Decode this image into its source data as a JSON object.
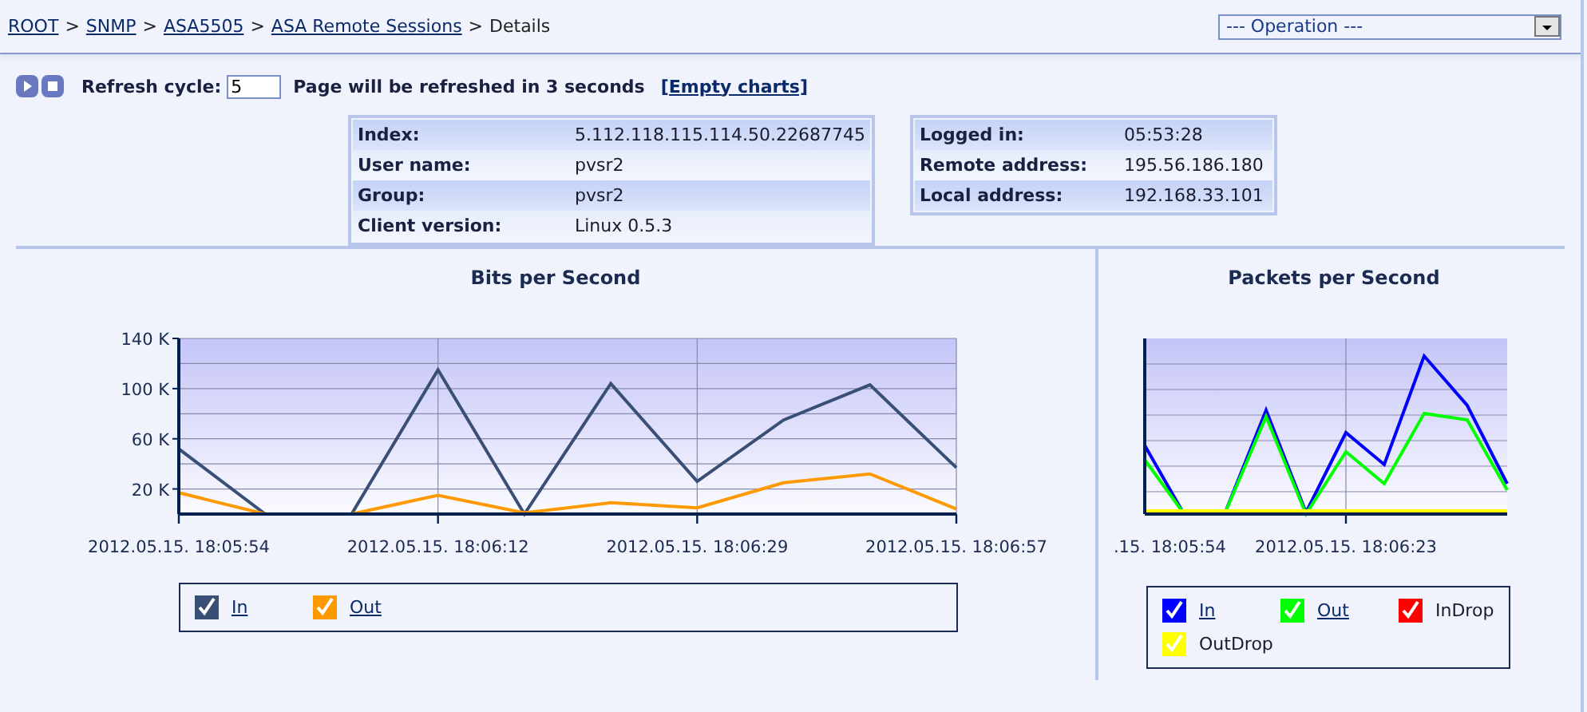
{
  "breadcrumb": {
    "separator": ">",
    "items": [
      {
        "label": "ROOT",
        "link": true
      },
      {
        "label": "SNMP",
        "link": true
      },
      {
        "label": "ASA5505",
        "link": true
      },
      {
        "label": "ASA Remote Sessions",
        "link": true
      },
      {
        "label": "Details",
        "link": false
      }
    ]
  },
  "operation_select": {
    "value": "--- Operation ---"
  },
  "toolbar": {
    "refresh_label": "Refresh cycle:",
    "refresh_value": "5",
    "status": "Page will be refreshed in 3 seconds",
    "empty_charts": "[Empty charts]"
  },
  "info_tables": [
    {
      "rows": [
        {
          "label": "Index:",
          "value": "5.112.118.115.114.50.22687745"
        },
        {
          "label": "User name:",
          "value": "pvsr2"
        },
        {
          "label": "Group:",
          "value": "pvsr2"
        },
        {
          "label": "Client version:",
          "value": "Linux 0.5.3"
        }
      ]
    },
    {
      "rows": [
        {
          "label": "Logged in:",
          "value": "05:53:28"
        },
        {
          "label": "Remote address:",
          "value": "195.56.186.180"
        },
        {
          "label": "Local address:",
          "value": "192.168.33.101"
        }
      ]
    }
  ],
  "bits_chart": {
    "chart_data": {
      "type": "line",
      "title": "Bits per Second",
      "categories": [
        "2012.05.15. 18:05:54",
        null,
        null,
        "2012.05.15. 18:06:12",
        null,
        null,
        "2012.05.15. 18:06:29",
        null,
        null,
        "2012.05.15. 18:06:57"
      ],
      "ylim": [
        0,
        140000
      ],
      "grid": true,
      "yticks": [
        {
          "value": 20000,
          "label": "20 K"
        },
        {
          "value": 60000,
          "label": "60 K"
        },
        {
          "value": 100000,
          "label": "100 K"
        },
        {
          "value": 140000,
          "label": "140 K"
        }
      ],
      "series": [
        {
          "name": "In",
          "color": "#3a4f75",
          "values": [
            52000,
            0,
            0,
            115000,
            0,
            104000,
            26000,
            75000,
            103000,
            37000
          ]
        },
        {
          "name": "Out",
          "color": "#ff9900",
          "values": [
            17000,
            0,
            0,
            15000,
            1000,
            9000,
            5000,
            25000,
            32000,
            4000
          ]
        }
      ]
    },
    "legend": [
      {
        "checked": true,
        "link": true
      },
      {
        "checked": true,
        "link": true
      }
    ]
  },
  "packets_chart": {
    "title": "Packets per Second",
    "x_labels": [
      ".15. 18:05:54",
      "2012.05.15. 18:06:23"
    ],
    "legend": [
      {
        "label": "In",
        "color": "#0000ff",
        "checked": true,
        "link": true
      },
      {
        "label": "Out",
        "color": "#00ff00",
        "checked": true,
        "link": true
      },
      {
        "label": "InDrop",
        "color": "#ff0000",
        "checked": true,
        "link": false
      },
      {
        "label": "OutDrop",
        "color": "#ffff00",
        "checked": true,
        "link": false
      }
    ]
  }
}
